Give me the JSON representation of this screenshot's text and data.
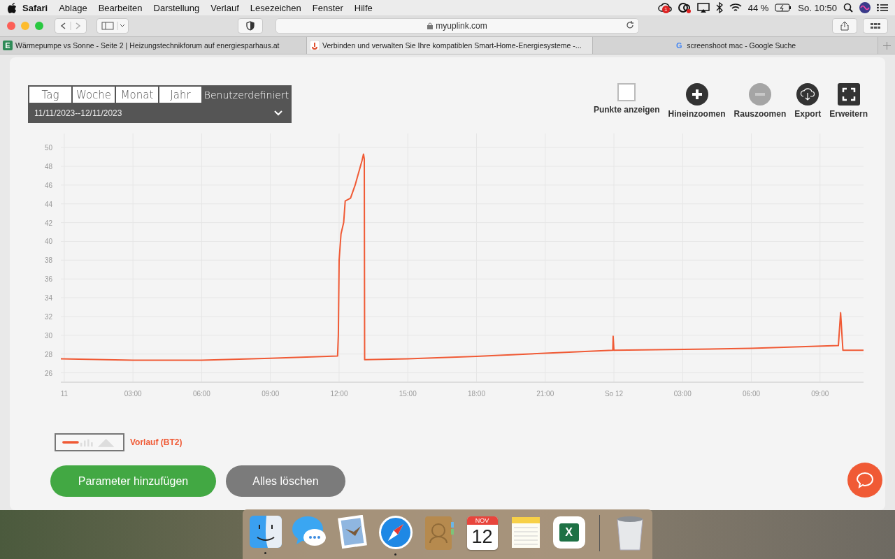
{
  "menu_bar": {
    "app": "Safari",
    "items": [
      "Ablage",
      "Bearbeiten",
      "Darstellung",
      "Verlauf",
      "Lesezeichen",
      "Fenster",
      "Hilfe"
    ],
    "cloud_badge": "1",
    "battery": "44 %",
    "clock": "So. 10:50"
  },
  "toolbar": {
    "address": "myuplink.com"
  },
  "tabs": [
    {
      "label": "Wärmepumpe vs Sonne - Seite 2 | Heizungstechnikforum auf energiesparhaus.at",
      "favicon": "E",
      "selected": false
    },
    {
      "label": "Verbinden und verwalten Sie Ihre kompatiblen Smart-Home-Energiesysteme -...",
      "selected": true
    },
    {
      "label": "screenshoot mac - Google Suche",
      "favicon": "G",
      "selected": false
    }
  ],
  "period_tabs": [
    {
      "label": "Tag",
      "selected": false
    },
    {
      "label": "Woche",
      "selected": false
    },
    {
      "label": "Monat",
      "selected": false
    },
    {
      "label": "Jahr",
      "selected": false
    },
    {
      "label": "Benutzerdefiniert",
      "selected": true
    }
  ],
  "date_range": "11/11/2023--12/11/2023",
  "actions": [
    {
      "kind": "checkbox",
      "label": "Punkte anzeigen",
      "checked": false
    },
    {
      "kind": "zoom-in",
      "label": "Hineinzoomen",
      "disabled": false
    },
    {
      "kind": "zoom-out",
      "label": "Rauszoomen",
      "disabled": true
    },
    {
      "kind": "export",
      "label": "Export",
      "disabled": false
    },
    {
      "kind": "expand",
      "label": "Erweitern",
      "disabled": false
    }
  ],
  "chart_data": {
    "type": "line",
    "grid": true,
    "xlim": [
      "2023-11-10T23:51",
      "2023-11-12T10:54"
    ],
    "ylim": [
      25,
      51.5
    ],
    "xticks": [
      {
        "value": "2023-11-11T00:00",
        "label": "11"
      },
      {
        "value": "2023-11-11T03:00",
        "label": "03:00"
      },
      {
        "value": "2023-11-11T06:00",
        "label": "06:00"
      },
      {
        "value": "2023-11-11T09:00",
        "label": "09:00"
      },
      {
        "value": "2023-11-11T12:00",
        "label": "12:00"
      },
      {
        "value": "2023-11-11T15:00",
        "label": "15:00"
      },
      {
        "value": "2023-11-11T18:00",
        "label": "18:00"
      },
      {
        "value": "2023-11-11T21:00",
        "label": "21:00"
      },
      {
        "value": "2023-11-12T00:00",
        "label": "So 12"
      },
      {
        "value": "2023-11-12T03:00",
        "label": "03:00"
      },
      {
        "value": "2023-11-12T06:00",
        "label": "06:00"
      },
      {
        "value": "2023-11-12T09:00",
        "label": "09:00"
      }
    ],
    "yticks": [
      26,
      28,
      30,
      32,
      34,
      36,
      38,
      40,
      42,
      44,
      46,
      48,
      50
    ],
    "x": [
      "2023-11-10T23:51",
      "2023-11-11T03:00",
      "2023-11-11T06:00",
      "2023-11-11T09:00",
      "2023-11-11T11:56",
      "2023-11-11T11:58",
      "2023-11-11T12:00",
      "2023-11-11T12:05",
      "2023-11-11T12:12",
      "2023-11-11T12:16",
      "2023-11-11T12:30",
      "2023-11-11T12:42",
      "2023-11-11T13:00",
      "2023-11-11T13:04",
      "2023-11-11T13:06",
      "2023-11-11T13:07",
      "2023-11-11T15:00",
      "2023-11-11T18:00",
      "2023-11-11T21:00",
      "2023-11-11T23:57",
      "2023-11-11T23:58",
      "2023-11-12T00:00",
      "2023-11-12T06:00",
      "2023-11-12T09:48",
      "2023-11-12T09:54",
      "2023-11-12T10:00",
      "2023-11-12T10:54"
    ],
    "series": [
      {
        "name": "Vorlauf (BT2)",
        "color": "#f05a35",
        "values": [
          27.5,
          27.35,
          27.35,
          27.55,
          27.8,
          30,
          38,
          40.8,
          42,
          44.3,
          44.6,
          46,
          48.6,
          49.3,
          48.8,
          27.4,
          27.5,
          27.75,
          28.1,
          28.4,
          29.9,
          28.4,
          28.6,
          28.9,
          32.4,
          28.4,
          28.4
        ]
      }
    ]
  },
  "buttons": [
    {
      "kind": "primary",
      "label": "Parameter hinzufügen"
    },
    {
      "kind": "secondary",
      "label": "Alles löschen"
    }
  ],
  "dock": [
    {
      "kind": "finder",
      "running": true
    },
    {
      "kind": "messages",
      "running": false
    },
    {
      "kind": "mail",
      "running": false
    },
    {
      "kind": "safari",
      "running": true
    },
    {
      "kind": "contacts",
      "running": false
    },
    {
      "kind": "calendar",
      "running": false,
      "month": "NOV",
      "day": "12"
    },
    {
      "kind": "notes",
      "running": false
    },
    {
      "kind": "excel",
      "running": false,
      "letter": "X"
    },
    {
      "kind": "trash",
      "running": false
    }
  ]
}
